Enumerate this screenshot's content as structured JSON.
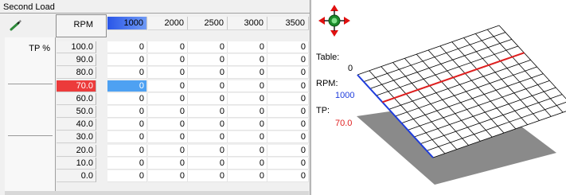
{
  "title": "Second Load",
  "table": {
    "rpm_header": "RPM",
    "tp_header": "TP %",
    "columns": [
      "1000",
      "2000",
      "2500",
      "3000",
      "3500"
    ],
    "selected_column": 0,
    "rows": [
      {
        "label": "100.0",
        "values": [
          "0",
          "0",
          "0",
          "0",
          "0"
        ]
      },
      {
        "label": "90.0",
        "values": [
          "0",
          "0",
          "0",
          "0",
          "0"
        ]
      },
      {
        "label": "80.0",
        "values": [
          "0",
          "0",
          "0",
          "0",
          "0"
        ]
      },
      {
        "label": "70.0",
        "values": [
          "0",
          "0",
          "0",
          "0",
          "0"
        ]
      },
      {
        "label": "60.0",
        "values": [
          "0",
          "0",
          "0",
          "0",
          "0"
        ]
      },
      {
        "label": "50.0",
        "values": [
          "0",
          "0",
          "0",
          "0",
          "0"
        ]
      },
      {
        "label": "40.0",
        "values": [
          "0",
          "0",
          "0",
          "0",
          "0"
        ]
      },
      {
        "label": "30.0",
        "values": [
          "0",
          "0",
          "0",
          "0",
          "0"
        ]
      },
      {
        "label": "20.0",
        "values": [
          "0",
          "0",
          "0",
          "0",
          "0"
        ]
      },
      {
        "label": "10.0",
        "values": [
          "0",
          "0",
          "0",
          "0",
          "0"
        ]
      },
      {
        "label": "0.0",
        "values": [
          "0",
          "0",
          "0",
          "0",
          "0"
        ]
      }
    ],
    "selected_row": 3
  },
  "plot": {
    "table_label": "Table:",
    "table_value": "0",
    "rpm_label": "RPM:",
    "rpm_value": "1000",
    "tp_label": "TP:",
    "tp_value": "70.0",
    "colors": {
      "rpm": "#1e3cdc",
      "tp": "#e02020",
      "nav_arrows": "#e01010",
      "nav_center": "#1a8a2a"
    }
  },
  "icons": {
    "tool": "wand-icon",
    "nav": "pan-arrows-icon"
  }
}
